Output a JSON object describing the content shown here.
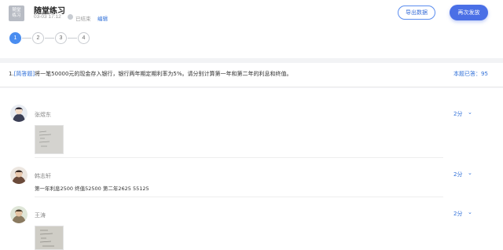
{
  "header": {
    "thumb_line1": "随堂",
    "thumb_line2": "练习",
    "title": "随堂练习",
    "date": "03-03 17:12",
    "status": "已结束",
    "edit_label": "编辑",
    "export_label": "导出数据",
    "resend_label": "再次发放"
  },
  "steps": [
    "1",
    "2",
    "3",
    "4"
  ],
  "question": {
    "number": "1.",
    "tag": "[简答题]",
    "text": "将一笔50000元的现金存入银行，银行两年期定期利率为5%。请分别计算第一年和第二年的利息和终值。",
    "answered_label": "本题已答：95"
  },
  "answers": [
    {
      "name": "张煜东",
      "score": "2分",
      "type": "image"
    },
    {
      "name": "韩志轩",
      "score": "2分",
      "type": "text",
      "text": "第一年利息2500 终值52500 第二年2625 55125"
    },
    {
      "name": "王涛",
      "score": "2分",
      "type": "image"
    }
  ],
  "colors": {
    "accent": "#4a6fe6",
    "link": "#2f6fd8",
    "active_step": "#4a8df0"
  }
}
